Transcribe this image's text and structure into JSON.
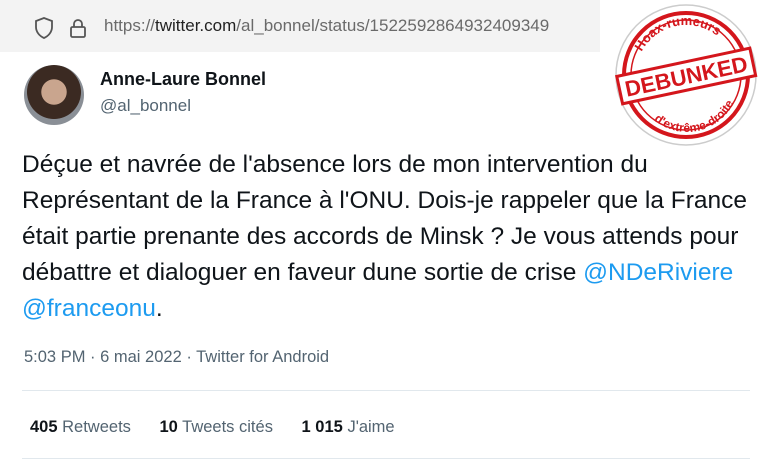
{
  "browser": {
    "url_prefix": "https://",
    "url_host": "twitter.com",
    "url_path": "/al_bonnel/status/1522592864932409349",
    "icons": [
      "shield-icon",
      "lock-icon"
    ]
  },
  "tweet": {
    "author_name": "Anne-Laure Bonnel",
    "author_handle": "@al_bonnel",
    "text_main": "Déçue et navrée de l'absence lors de mon intervention du Représentant de la France à l'ONU. Dois-je rappeler que la France était partie prenante des accords de Minsk ? Je vous attends pour débattre et dialoguer en faveur dune sortie de crise ",
    "mention_1": "@NDeRiviere",
    "mention_2": "@franceonu",
    "text_end": ".",
    "meta": "5:03 PM · 6 mai 2022 · Twitter for Android",
    "retweets_count": "405",
    "retweets_label": "Retweets",
    "quotes_count": "10",
    "quotes_label": "Tweets cités",
    "likes_count": "1 015",
    "likes_label": "J'aime"
  },
  "stamp": {
    "top_text": "Hoax-rumeurs",
    "main_text": "DEBUNKED",
    "bottom_text": "d'extrême-droite",
    "color": "#d4161c"
  },
  "colors": {
    "text": "#0f1419",
    "secondary": "#536471",
    "link": "#1d9bf0"
  }
}
